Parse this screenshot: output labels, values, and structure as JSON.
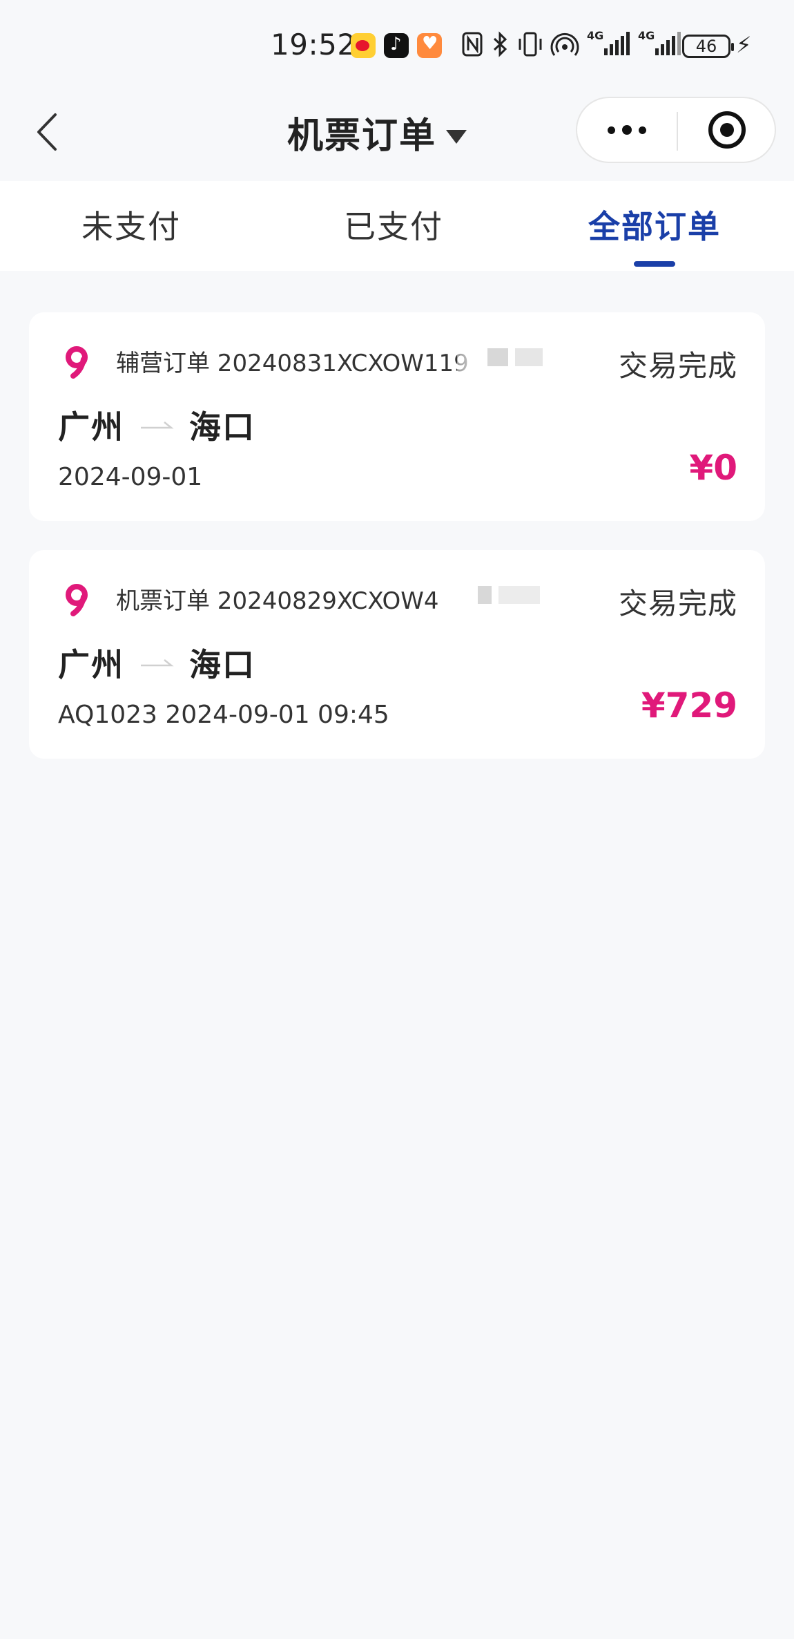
{
  "status_bar": {
    "time": "19:52",
    "net1": "4G",
    "net2": "4G",
    "battery": "46"
  },
  "nav": {
    "title": "机票订单"
  },
  "tabs": [
    {
      "label": "未支付",
      "active": false
    },
    {
      "label": "已支付",
      "active": false
    },
    {
      "label": "全部订单",
      "active": true
    }
  ],
  "orders": [
    {
      "order_no": "辅营订单 20240831XCXOW119",
      "status": "交易完成",
      "from": "广州",
      "to": "海口",
      "date": "2024-09-01",
      "price": "¥0"
    },
    {
      "order_no": "机票订单 20240829XCXOW4",
      "status": "交易完成",
      "from": "广州",
      "to": "海口",
      "date": "AQ1023 2024-09-01 09:45",
      "price": "¥729"
    }
  ],
  "colors": {
    "accent": "#1a3fa8",
    "price": "#e0197a",
    "brand": "#e0197a"
  }
}
